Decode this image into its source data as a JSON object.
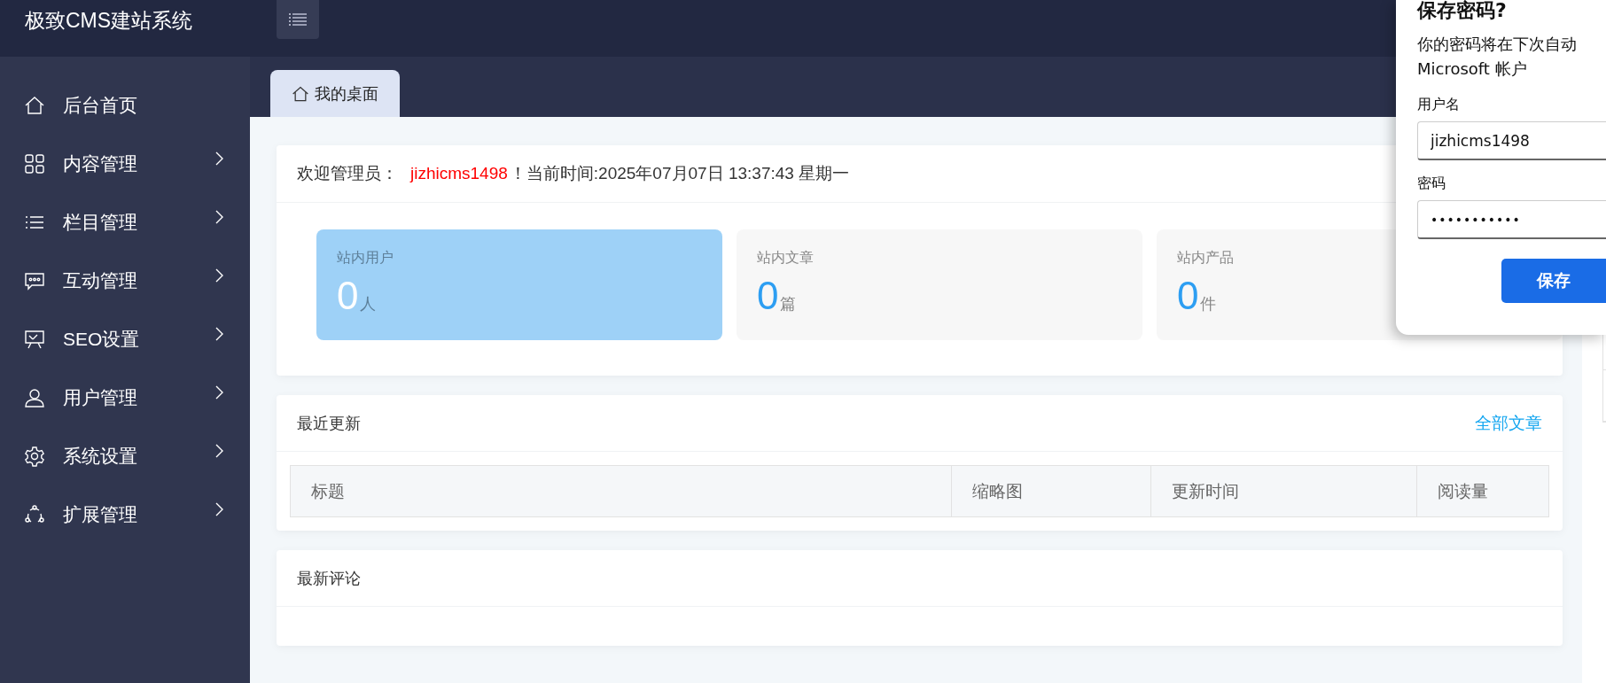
{
  "header": {
    "logo": "极致CMS建站系统"
  },
  "sidebar": {
    "items": [
      {
        "label": "后台首页",
        "kind": "home",
        "expandable": false
      },
      {
        "label": "内容管理",
        "kind": "grid",
        "expandable": true
      },
      {
        "label": "栏目管理",
        "kind": "list",
        "expandable": true
      },
      {
        "label": "互动管理",
        "kind": "chat",
        "expandable": true
      },
      {
        "label": "SEO设置",
        "kind": "board",
        "expandable": true
      },
      {
        "label": "用户管理",
        "kind": "user",
        "expandable": true
      },
      {
        "label": "系统设置",
        "kind": "gear",
        "expandable": true
      },
      {
        "label": "扩展管理",
        "kind": "nodes",
        "expandable": true
      }
    ]
  },
  "tabs": [
    {
      "label": "我的桌面",
      "selected": true
    }
  ],
  "welcome": {
    "prefix": "欢迎管理员：",
    "username": "jizhicms1498",
    "suffix": "！当前时间:2025年07月07日 13:37:43 星期一"
  },
  "stats": [
    {
      "label": "站内用户",
      "value": "0",
      "unit": "人",
      "highlighted": true
    },
    {
      "label": "站内文章",
      "value": "0",
      "unit": "篇",
      "highlighted": false
    },
    {
      "label": "站内产品",
      "value": "0",
      "unit": "件",
      "highlighted": false
    }
  ],
  "recent_updates": {
    "title": "最近更新",
    "link": "全部文章",
    "columns": [
      "标题",
      "缩略图",
      "更新时间",
      "阅读量"
    ]
  },
  "latest_comments": {
    "title": "最新评论"
  },
  "save_password_dialog": {
    "title": "保存密码?",
    "message_line_1": "你的密码将在下次自动",
    "message_line_2": "Microsoft 帐户",
    "username_label": "用户名",
    "username_value": "jizhicms1498",
    "password_label": "密码",
    "password_value": "•••••••••••",
    "save_button": "保存"
  }
}
